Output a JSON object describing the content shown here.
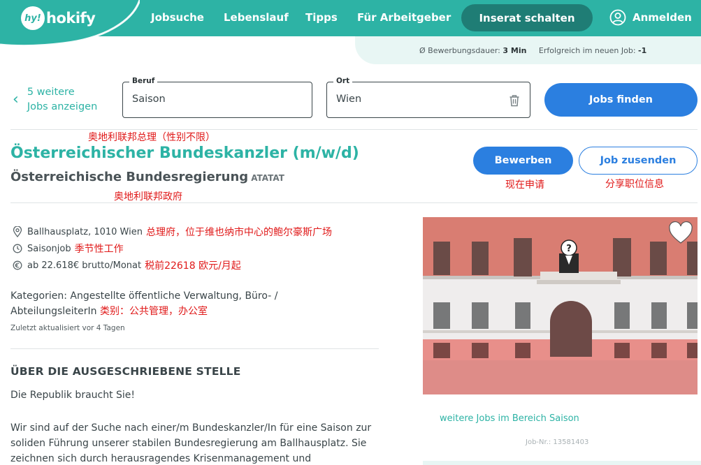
{
  "header": {
    "logo_badge": "hy!",
    "logo_text": "hokify",
    "nav": [
      "Jobsuche",
      "Lebenslauf",
      "Tipps",
      "Für Arbeitgeber"
    ],
    "cta": "Inserat schalten",
    "login": "Anmelden"
  },
  "stats": {
    "duration_label": "Ø Bewerbungsdauer:",
    "duration_value": "3 Min",
    "success_label": "Erfolgreich im neuen Job:",
    "success_value": "-1"
  },
  "search": {
    "back_line1": "5 weitere",
    "back_line2": "Jobs anzeigen",
    "beruf_label": "Beruf",
    "beruf_value": "Saison",
    "ort_label": "Ort",
    "ort_value": "Wien",
    "find_button": "Jobs finden"
  },
  "job": {
    "title_annotation": "奥地利联邦总理（性别不限）",
    "title": "Österreichischer Bundeskanzler (m/w/d)",
    "employer": "Österreichische Bundesregierung",
    "employer_code": "ATATAT",
    "employer_annotation": "奥地利联邦政府",
    "apply_button": "Bewerben",
    "apply_annotation": "现在申请",
    "send_button": "Job zusenden",
    "send_annotation": "分享职位信息",
    "location": "Ballhausplatz, 1010 Wien",
    "location_annotation": "总理府，位于维也纳市中心的鲍尔豪斯广场",
    "job_type": "Saisonjob",
    "job_type_annotation": "季节性工作",
    "salary": "ab 22.618€ brutto/Monat",
    "salary_annotation": "税前22618 欧元/月起",
    "categories": "Kategorien: Angestellte öffentliche Verwaltung, Büro- / AbteilungsleiterIn",
    "categories_annotation": "类别：公共管理，办公室",
    "updated": "Zuletzt aktualisiert vor 4 Tagen",
    "section_title": "ÜBER DIE AUSGESCHRIEBENE STELLE",
    "para1": "Die Republik braucht Sie!",
    "para2": "Wir sind auf der Suche nach einer/m Bundeskanzler/In für eine Saison zur soliden Führung unserer stabilen Bundesregierung am Ballhausplatz. Sie zeichnen sich durch herausragendes Krisenmanagement und",
    "more_jobs": "weitere Jobs im Bereich Saison",
    "job_number": "Job-Nr.: 13581403"
  },
  "colors": {
    "brand_teal": "#2db3a5",
    "brand_dark_teal": "#1f7d75",
    "action_blue": "#2b7fe0",
    "annotation_red": "#e01919"
  }
}
